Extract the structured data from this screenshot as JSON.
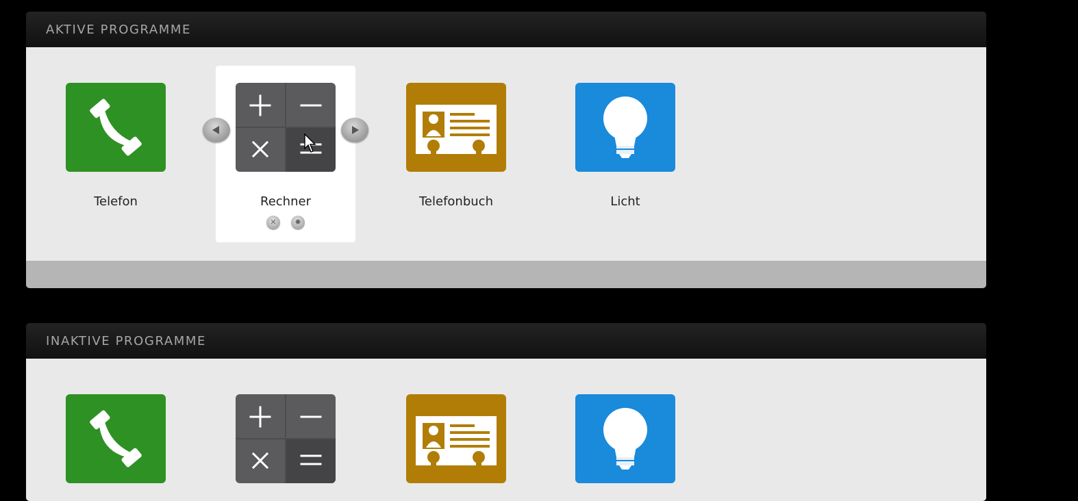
{
  "active": {
    "header": "AKTIVE PROGRAMME",
    "apps": [
      {
        "label": "Telefon",
        "icon": "phone-icon",
        "color": "#2e9124"
      },
      {
        "label": "Rechner",
        "icon": "calculator-icon",
        "color": "#5b5b5d",
        "selected": true
      },
      {
        "label": "Telefonbuch",
        "icon": "contact-card-icon",
        "color": "#b27d07"
      },
      {
        "label": "Licht",
        "icon": "lightbulb-icon",
        "color": "#1a8adb"
      }
    ],
    "controls": {
      "move_left_icon": "arrow-left-icon",
      "move_right_icon": "arrow-right-icon",
      "close_icon": "close-icon",
      "settings_icon": "gear-icon"
    }
  },
  "inactive": {
    "header": "INAKTIVE PROGRAMME",
    "apps": [
      {
        "icon": "phone-icon",
        "color": "#2e9124"
      },
      {
        "icon": "calculator-icon",
        "color": "#5b5b5d"
      },
      {
        "icon": "contact-card-icon",
        "color": "#b27d07"
      },
      {
        "icon": "lightbulb-icon",
        "color": "#1a8adb"
      }
    ]
  }
}
